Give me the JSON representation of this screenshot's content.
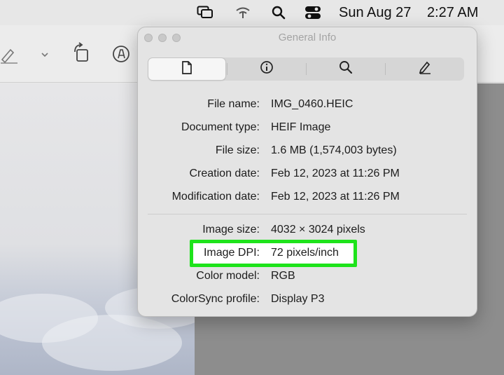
{
  "menubar": {
    "date": "Sun Aug 27",
    "time": "2:27 AM",
    "icons": [
      "screen-mirroring-icon",
      "wifi-icon",
      "search-icon",
      "control-center-icon"
    ]
  },
  "toolbar": {
    "icons": [
      "markup-pen-icon",
      "chevron-down-icon",
      "rotate-icon",
      "annotate-icon"
    ]
  },
  "panel": {
    "title": "General Info",
    "tabs": [
      {
        "name": "general",
        "icon": "document-icon",
        "selected": true
      },
      {
        "name": "more-info",
        "icon": "info-icon",
        "selected": false
      },
      {
        "name": "keywords",
        "icon": "magnifier-icon",
        "selected": false
      },
      {
        "name": "annotations",
        "icon": "pencil-icon",
        "selected": false
      }
    ],
    "rows": [
      {
        "label": "File name:",
        "value": "IMG_0460.HEIC"
      },
      {
        "label": "Document type:",
        "value": "HEIF Image"
      },
      {
        "label": "File size:",
        "value": "1.6 MB (1,574,003 bytes)"
      },
      {
        "label": "Creation date:",
        "value": "Feb 12, 2023 at 11:26 PM"
      },
      {
        "label": "Modification date:",
        "value": "Feb 12, 2023 at 11:26 PM"
      }
    ],
    "image_rows": [
      {
        "label": "Image size:",
        "value": "4032 × 3024 pixels"
      },
      {
        "label": "Image DPI:",
        "value": "72 pixels/inch"
      },
      {
        "label": "Color model:",
        "value": "RGB"
      },
      {
        "label": "ColorSync profile:",
        "value": "Display P3"
      }
    ],
    "highlight_color": "#1ee31b"
  }
}
